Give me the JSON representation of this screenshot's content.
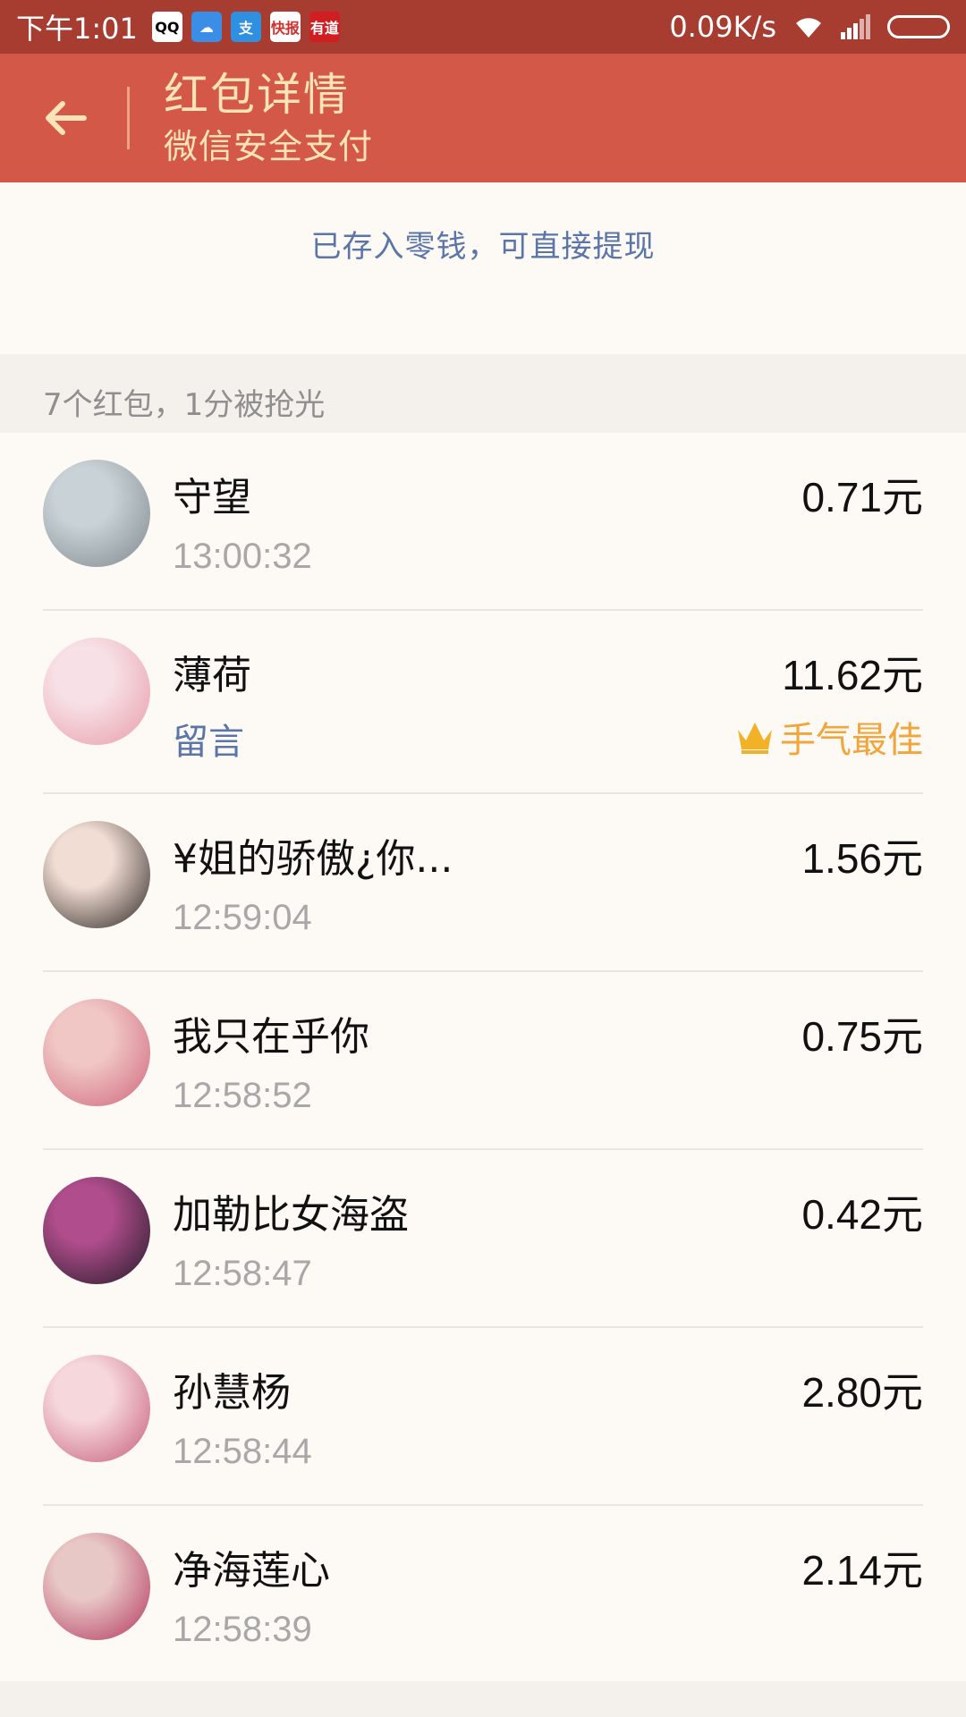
{
  "status_bar": {
    "time": "下午1:01",
    "apps": [
      {
        "icon": "qq-icon",
        "label": "QQ",
        "color": "#ffffff",
        "fg": "#000000"
      },
      {
        "icon": "cloud-icon",
        "label": "☁",
        "color": "#3a8ee6",
        "fg": "#ffffff"
      },
      {
        "icon": "alipay-icon",
        "label": "支",
        "color": "#2f8fe0",
        "fg": "#ffffff"
      },
      {
        "icon": "kuaibao-icon",
        "label": "快报",
        "color": "#ffffff",
        "fg": "#d2302c"
      },
      {
        "icon": "youdao-icon",
        "label": "有道",
        "color": "#d11e22",
        "fg": "#ffffff"
      }
    ],
    "net_speed": "0.09K/s"
  },
  "header": {
    "title": "红包详情",
    "subtitle": "微信安全支付"
  },
  "notice": {
    "text": "已存入零钱，可直接提现"
  },
  "summary": {
    "text": "7个红包，1分被抢光"
  },
  "records": [
    {
      "name": "守望",
      "time": "13:00:32",
      "amount": "0.71元",
      "avatar_colors": [
        "#c9d2d6",
        "#7f8a8e"
      ]
    },
    {
      "name": "薄荷",
      "comment_label": "留言",
      "amount": "11.62元",
      "best_label": "手气最佳",
      "avatar_colors": [
        "#f7e1e6",
        "#e89aa8"
      ]
    },
    {
      "name": "¥姐的骄傲¿你...",
      "time": "12:59:04",
      "amount": "1.56元",
      "avatar_colors": [
        "#f1ddd3",
        "#2b2422"
      ]
    },
    {
      "name": "我只在乎你",
      "time": "12:58:52",
      "amount": "0.75元",
      "avatar_colors": [
        "#f0c7c4",
        "#d0657c"
      ]
    },
    {
      "name": "加勒比女海盗",
      "time": "12:58:47",
      "amount": "0.42元",
      "avatar_colors": [
        "#b04d8c",
        "#221a26"
      ]
    },
    {
      "name": "孙慧杨",
      "time": "12:58:44",
      "amount": "2.80元",
      "avatar_colors": [
        "#f6d7dc",
        "#c65b79"
      ]
    },
    {
      "name": "净海莲心",
      "time": "12:58:39",
      "amount": "2.14元",
      "avatar_colors": [
        "#e8c8c6",
        "#b2345c"
      ]
    }
  ]
}
